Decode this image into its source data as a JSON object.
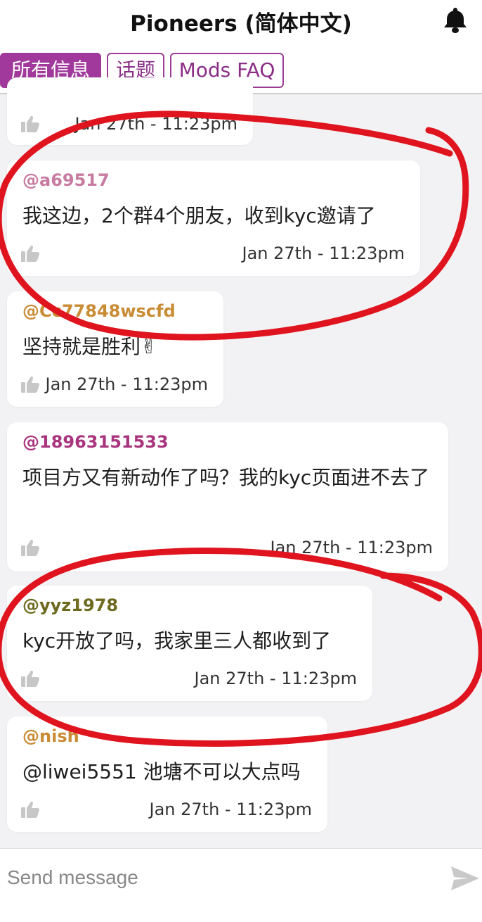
{
  "header": {
    "title": "Pioneers (简体中文)",
    "bell_icon": "bell-icon"
  },
  "tabs": [
    {
      "label": "所有信息",
      "active": true
    },
    {
      "label": "话题",
      "active": false
    },
    {
      "label": "Mods FAQ",
      "active": false
    }
  ],
  "messages": [
    {
      "username": "",
      "text": "",
      "time": "Jan 27th - 11:23pm",
      "user_color": "#c0392b"
    },
    {
      "username": "@a69517",
      "text": "我这边，2个群4个朋友，收到kyc邀请了",
      "time": "Jan 27th - 11:23pm",
      "user_color": "#c77ba0"
    },
    {
      "username": "@Cc77848wscfd",
      "text": "坚持就是胜利✌",
      "time": "Jan 27th - 11:23pm",
      "user_color": "#c98b34"
    },
    {
      "username": "@18963151533",
      "text": "项目方又有新动作了吗？我的kyc页面进不去了",
      "time": "Jan 27th - 11:23pm",
      "user_color": "#a8357e"
    },
    {
      "username": "@yyz1978",
      "text": "kyc开放了吗，我家里三人都收到了",
      "time": "Jan 27th - 11:23pm",
      "user_color": "#6d6a1f"
    },
    {
      "username": "@nish",
      "text": "@liwei5551 池塘不可以大点吗",
      "time": "Jan 27th - 11:23pm",
      "user_color": "#c98b34"
    }
  ],
  "composer": {
    "placeholder": "Send message",
    "send_icon": "send-icon"
  },
  "colors": {
    "accent": "#a0399b",
    "annotation": "#e0141e"
  }
}
